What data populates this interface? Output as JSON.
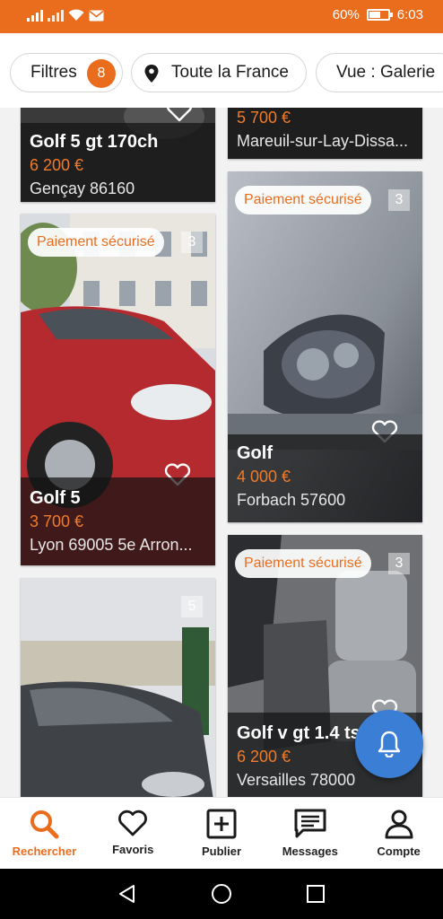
{
  "status_bar": {
    "battery": "60%",
    "battery_level": 0.6,
    "time": "6:03"
  },
  "filters": {
    "filtres_label": "Filtres",
    "filtres_count": "8",
    "location_label": "Toute la France",
    "view_label": "Vue : Galerie"
  },
  "cards": [
    {
      "title": "Golf 5 gt 170ch",
      "price": "6 200 €",
      "place": "Gençay 86160"
    },
    {
      "title": "",
      "price": "5 700 €",
      "place": "Mareuil-sur-Lay-Dissa..."
    },
    {
      "pay": "Paiement sécurisé",
      "count": "3",
      "title": "Golf",
      "price": "4 000 €",
      "place": "Forbach 57600"
    },
    {
      "pay": "Paiement sécurisé",
      "count": "3",
      "title": "Golf 5",
      "price": "3 700 €",
      "place": "Lyon 69005 5e Arron..."
    },
    {
      "count": "5"
    },
    {
      "pay": "Paiement sécurisé",
      "count": "3",
      "title": "Golf v gt 1.4 tsi",
      "price": "6 200 €",
      "place": "Versailles 78000"
    }
  ],
  "nav": [
    {
      "label": "Rechercher",
      "icon": "search-icon",
      "active": true
    },
    {
      "label": "Favoris",
      "icon": "heart-icon"
    },
    {
      "label": "Publier",
      "icon": "plus-square-icon"
    },
    {
      "label": "Messages",
      "icon": "message-icon"
    },
    {
      "label": "Compte",
      "icon": "user-icon"
    }
  ],
  "colors": {
    "accent": "#ea6d1e",
    "fab": "#3b7ed6"
  }
}
